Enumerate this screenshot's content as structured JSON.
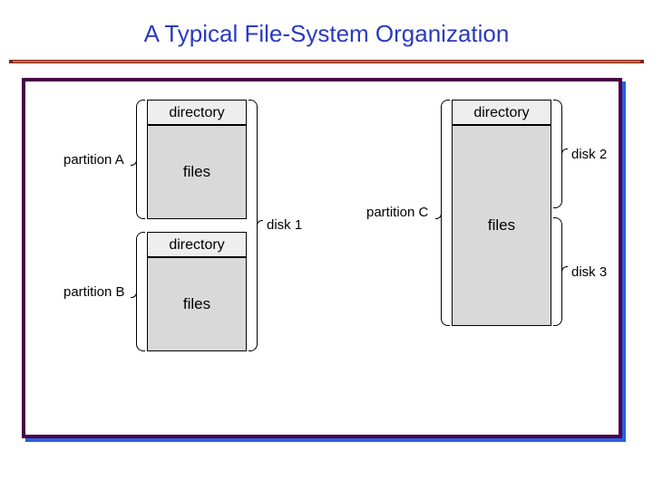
{
  "title": "A Typical File-System Organization",
  "labels": {
    "partitionA": "partition A",
    "partitionB": "partition B",
    "partitionC": "partition C",
    "disk1": "disk 1",
    "disk2": "disk 2",
    "disk3": "disk 3",
    "directory": "directory",
    "files": "files"
  },
  "chart_data": {
    "type": "diagram",
    "description": "File-system organization: disk 1 holds partitions A and B (each directory+files); disks 2 and 3 together hold partition C (directory on disk 2, files spanning both).",
    "disks": [
      {
        "name": "disk 1",
        "partitions": [
          "partition A",
          "partition B"
        ]
      },
      {
        "name": "disk 2",
        "partitions": [
          "partition C (part)"
        ]
      },
      {
        "name": "disk 3",
        "partitions": [
          "partition C (part)"
        ]
      }
    ],
    "partitions": [
      {
        "name": "partition A",
        "contents": [
          "directory",
          "files"
        ],
        "disks": [
          "disk 1"
        ]
      },
      {
        "name": "partition B",
        "contents": [
          "directory",
          "files"
        ],
        "disks": [
          "disk 1"
        ]
      },
      {
        "name": "partition C",
        "contents": [
          "directory",
          "files"
        ],
        "disks": [
          "disk 2",
          "disk 3"
        ]
      }
    ]
  }
}
